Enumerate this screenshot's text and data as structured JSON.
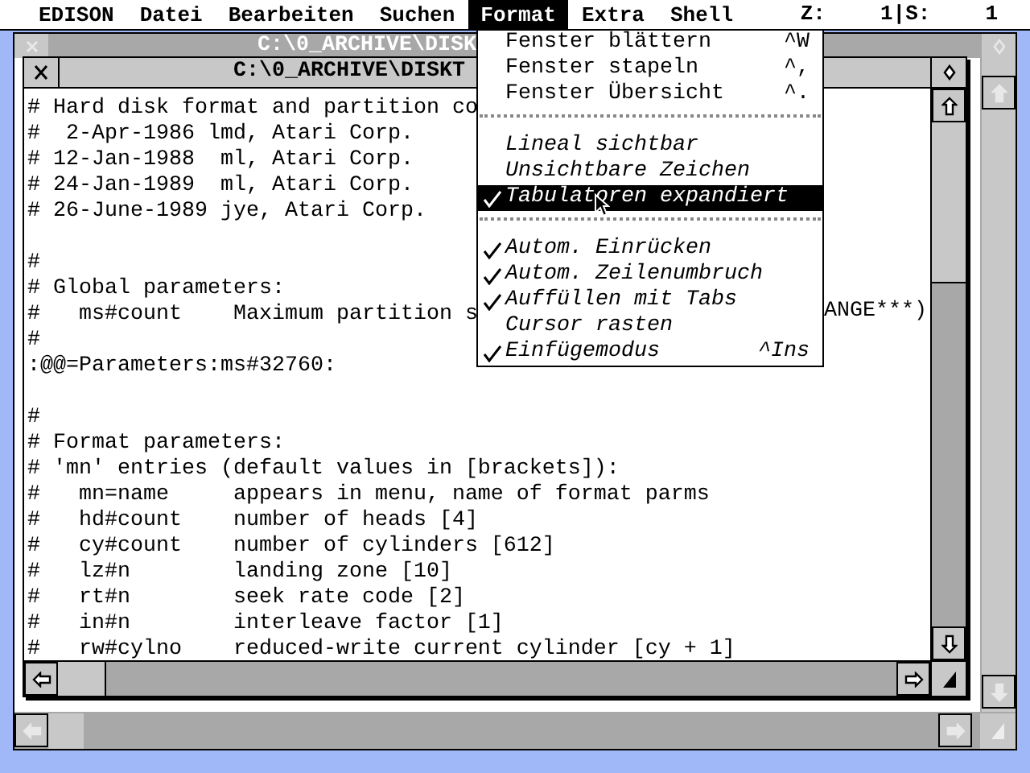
{
  "menu_bar": {
    "items": [
      {
        "label": "EDISON",
        "selected": false
      },
      {
        "label": "Datei",
        "selected": false
      },
      {
        "label": "Bearbeiten",
        "selected": false
      },
      {
        "label": "Suchen",
        "selected": false
      },
      {
        "label": "Format",
        "selected": true
      },
      {
        "label": "Extra",
        "selected": false
      },
      {
        "label": "Shell",
        "selected": false
      }
    ],
    "status": [
      "Z:",
      "1|S:",
      "1"
    ]
  },
  "back_window": {
    "title": "C:\\0_ARCHIVE\\DISK"
  },
  "front_window": {
    "title": "C:\\0_ARCHIVE\\DISKT",
    "lines": [
      {
        "kind": "text",
        "text": "# Hard disk format and partition co"
      },
      {
        "kind": "text",
        "text": "#  2-Apr-1986 lmd, Atari Corp."
      },
      {
        "kind": "text",
        "text": "# 12-Jan-1988  ml, Atari Corp."
      },
      {
        "kind": "text",
        "text": "# 24-Jan-1989  ml, Atari Corp."
      },
      {
        "kind": "text",
        "text": "# 26-June-1989 jye, Atari Corp."
      },
      {
        "kind": "blank"
      },
      {
        "kind": "text",
        "text": "#"
      },
      {
        "kind": "text",
        "text": "# Global parameters:"
      },
      {
        "kind": "text",
        "text": "#   ms#count    Maximum partition s",
        "tail": "ANGE***)"
      },
      {
        "kind": "text",
        "text": "#"
      },
      {
        "kind": "text",
        "text": ":@@=Parameters:ms#32760:"
      },
      {
        "kind": "blank"
      },
      {
        "kind": "text",
        "text": "#"
      },
      {
        "kind": "text",
        "text": "# Format parameters:"
      },
      {
        "kind": "text",
        "text": "# 'mn' entries (default values in [brackets]):"
      },
      {
        "kind": "text",
        "text": "#   mn=name     appears in menu, name of format parms"
      },
      {
        "kind": "text",
        "text": "#   hd#count    number of heads [4]"
      },
      {
        "kind": "text",
        "text": "#   cy#count    number of cylinders [612]"
      },
      {
        "kind": "text",
        "text": "#   lz#n        landing zone [10]"
      },
      {
        "kind": "text",
        "text": "#   rt#n        seek rate code [2]"
      },
      {
        "kind": "text",
        "text": "#   in#n        interleave factor [1]"
      },
      {
        "kind": "text",
        "text": "#   rw#cylno    reduced-write current cylinder [cy + 1]"
      }
    ]
  },
  "dropdown": {
    "items": [
      {
        "kind": "command",
        "label": "Fenster blättern",
        "shortcut": "^W",
        "selected": false
      },
      {
        "kind": "command",
        "label": "Fenster stapeln",
        "shortcut": "^,",
        "selected": false
      },
      {
        "kind": "command",
        "label": "Fenster Übersicht",
        "shortcut": "^.",
        "selected": false
      },
      {
        "kind": "separator"
      },
      {
        "kind": "toggle",
        "label": "Lineal sichtbar",
        "checked": false,
        "selected": false
      },
      {
        "kind": "toggle",
        "label": "Unsichtbare Zeichen",
        "checked": false,
        "selected": false
      },
      {
        "kind": "toggle",
        "label": "Tabulatoren expandiert",
        "checked": true,
        "selected": true
      },
      {
        "kind": "separator"
      },
      {
        "kind": "toggle",
        "label": "Autom. Einrücken",
        "checked": true,
        "selected": false
      },
      {
        "kind": "toggle",
        "label": "Autom. Zeilenumbruch",
        "checked": true,
        "selected": false
      },
      {
        "kind": "toggle",
        "label": "Auffüllen mit Tabs",
        "checked": true,
        "selected": false
      },
      {
        "kind": "toggle",
        "label": "Cursor rasten",
        "checked": false,
        "selected": false
      },
      {
        "kind": "toggle",
        "label": "Einfügemodus",
        "checked": true,
        "selected": false,
        "shortcut": "^Ins"
      }
    ]
  }
}
